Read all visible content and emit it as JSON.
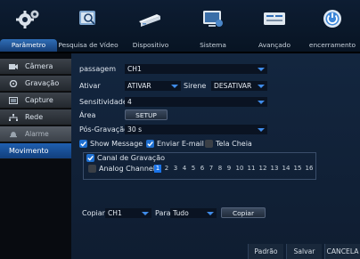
{
  "topbar": {
    "icons": [
      "gear-icon",
      "camera-search-icon",
      "device-icon",
      "system-icon",
      "advanced-icon",
      "power-icon"
    ],
    "tabs": [
      "Parâmetro",
      "Pesquisa de Vídeo",
      "Dispositivo",
      "Sistema",
      "Avançado",
      "encerramento"
    ],
    "active_tab": "Parâmetro"
  },
  "sidebar": {
    "items": [
      {
        "label": "Câmera",
        "icon": "camera-icon"
      },
      {
        "label": "Gravação",
        "icon": "record-gear-icon"
      },
      {
        "label": "Capture",
        "icon": "capture-icon"
      },
      {
        "label": "Rede",
        "icon": "network-icon"
      },
      {
        "label": "Alarme",
        "icon": "alarm-icon"
      },
      {
        "label": "Movimento"
      }
    ],
    "active": "Movimento"
  },
  "form": {
    "channel_label": "passagem",
    "channel_value": "CH1",
    "enable_label": "Ativar",
    "enable_value": "ATIVAR",
    "siren_label": "Sirene",
    "siren_value": "DESATIVAR",
    "sensitivity_label": "Sensitividade",
    "sensitivity_value": "4",
    "area_label": "Área",
    "area_button": "SETUP",
    "post_rec_label": "Pós-Gravação",
    "post_rec_value": "30 s",
    "show_message_label": "Show Message",
    "show_message_checked": true,
    "email_label": "Enviar E-mail",
    "email_checked": true,
    "fullscreen_label": "Tela Cheia",
    "fullscreen_checked": false,
    "rec_channel_label": "Canal de Gravação",
    "rec_channel_checked": true,
    "analog_label": "Analog Channels",
    "analog_checked": false,
    "channels": [
      "1",
      "2",
      "3",
      "4",
      "5",
      "6",
      "7",
      "8",
      "9",
      "10",
      "11",
      "12",
      "13",
      "14",
      "15",
      "16"
    ],
    "selected_channel": "1"
  },
  "copy": {
    "copy_label": "Copiar",
    "from_value": "CH1",
    "to_label": "Para",
    "to_value": "Tudo",
    "copy_button": "Copiar"
  },
  "footer": {
    "default_button": "Padrão",
    "save_button": "Salvar",
    "cancel_button": "CANCELA"
  },
  "colors": {
    "accent": "#1e6fd0",
    "panel": "#13263f",
    "field": "#0a1322"
  }
}
